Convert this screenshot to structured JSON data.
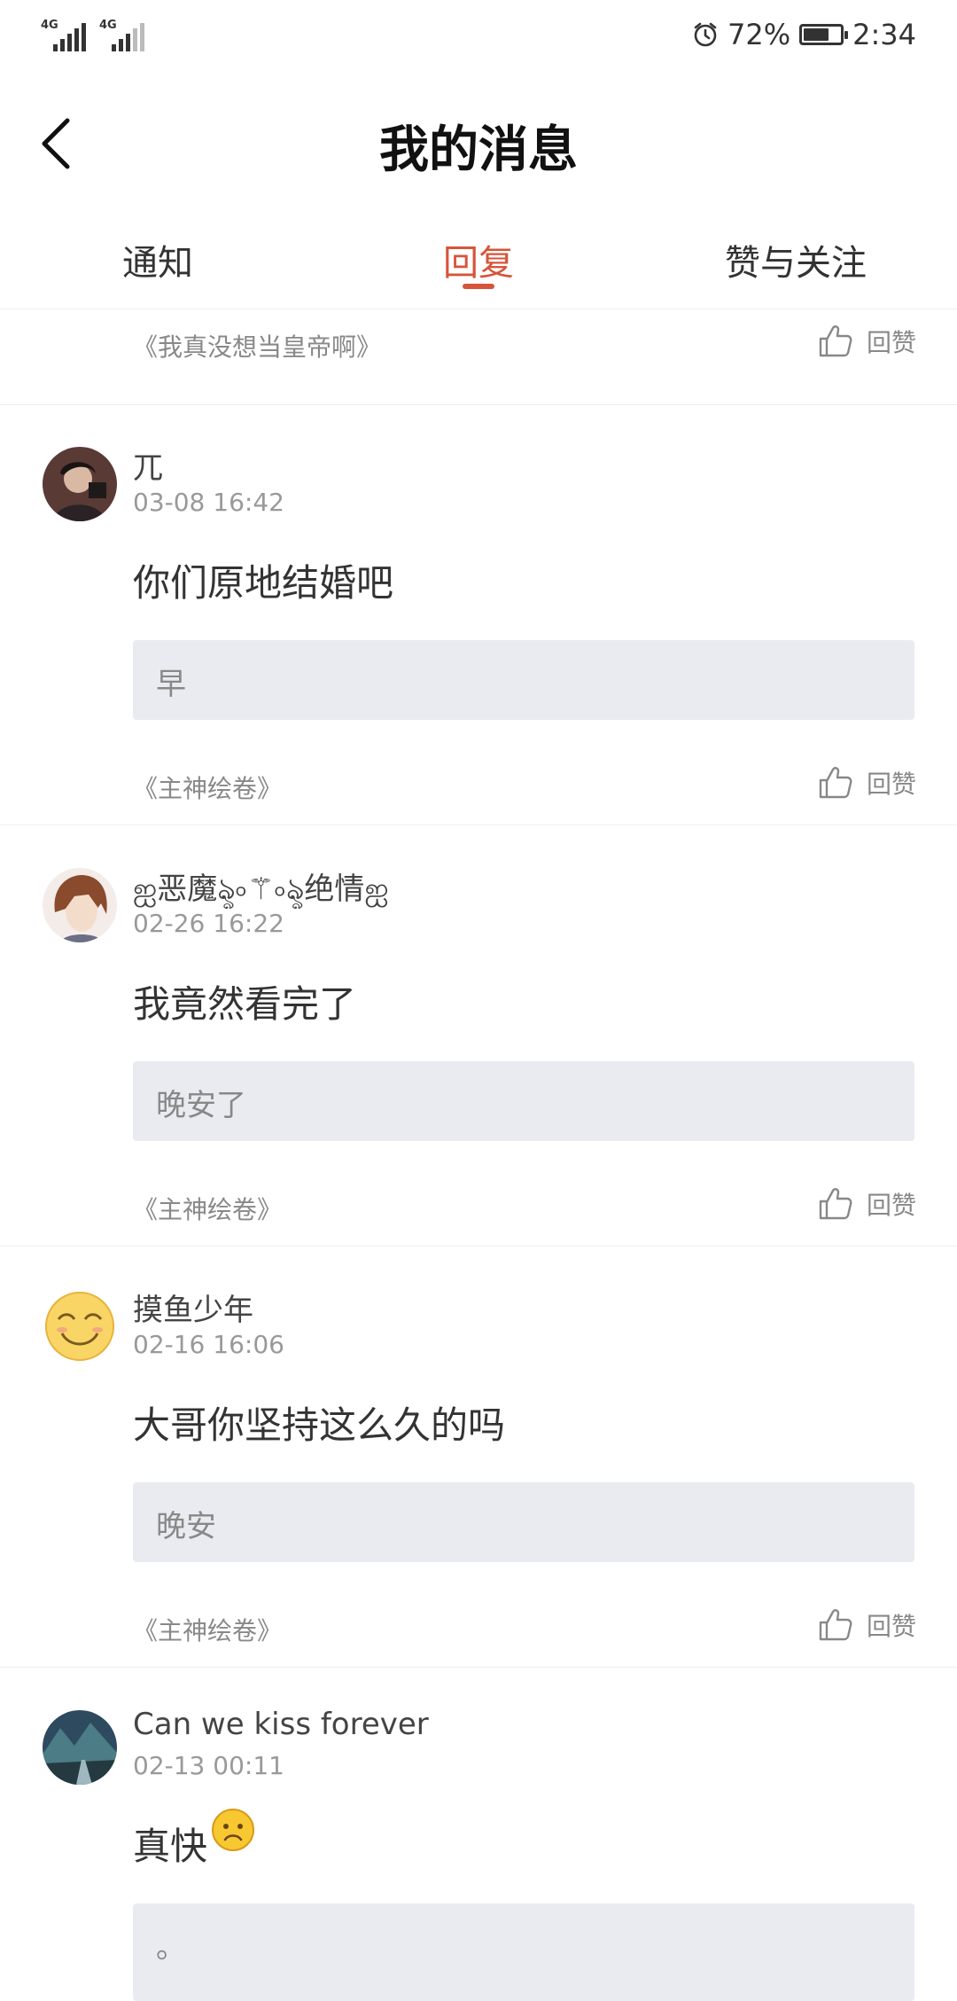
{
  "status_bar": {
    "signal1": "4G",
    "signal2": "4G",
    "battery_percent": "72%",
    "battery_level": 0.72,
    "time": "2:34"
  },
  "header": {
    "title": "我的消息"
  },
  "tabs": [
    {
      "label": "通知"
    },
    {
      "label": "回复"
    },
    {
      "label": "赞与关注"
    }
  ],
  "active_tab": "回复",
  "prev_item": {
    "book": "《我真没想当皇帝啊》",
    "like_label": "回赞"
  },
  "messages": [
    {
      "name": "兀",
      "time": "03-08 16:42",
      "content": "你们原地结婚吧",
      "quote": "早",
      "book": "《主神绘卷》",
      "like_label": "回赞"
    },
    {
      "name": "ஐ恶魔ৡ৹⚚৹ৡ绝情ஐ",
      "time": "02-26 16:22",
      "content": "我竟然看完了",
      "quote": "晚安了",
      "book": "《主神绘卷》",
      "like_label": "回赞"
    },
    {
      "name": "摸鱼少年",
      "time": "02-16 16:06",
      "content": "大哥你坚持这么久的吗",
      "quote": "晚安",
      "book": "《主神绘卷》",
      "like_label": "回赞"
    },
    {
      "name": "Can we kiss forever",
      "time": "02-13 00:11",
      "content": "真快",
      "quote": "。",
      "book": "",
      "like_label": ""
    }
  ],
  "colors": {
    "accent": "#d6553a",
    "quote_bg": "#e9ebf1"
  },
  "icons": [
    "back-arrow-icon",
    "alarm-icon",
    "battery-icon",
    "signal-icon",
    "thumbs-up-icon",
    "sad-face-emoji"
  ]
}
